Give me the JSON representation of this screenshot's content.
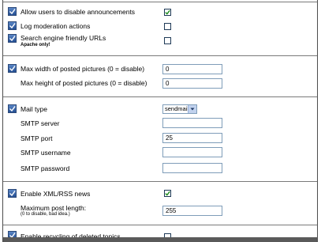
{
  "rows": {
    "allow_disable": {
      "label": "Allow users to disable announcements",
      "checked": true
    },
    "log_moderation": {
      "label": "Log moderation actions",
      "checked": false
    },
    "seo_urls": {
      "label": "Search engine friendly URLs",
      "sublabel": "Apache only!",
      "checked": false
    },
    "max_width": {
      "label": "Max width of posted pictures (0 = disable)",
      "value": "0"
    },
    "max_height": {
      "label": "Max height of posted pictures (0 = disable)",
      "value": "0"
    },
    "mail_type": {
      "label": "Mail type",
      "value": "sendmail"
    },
    "smtp_server": {
      "label": "SMTP server",
      "value": ""
    },
    "smtp_port": {
      "label": "SMTP port",
      "value": "25"
    },
    "smtp_username": {
      "label": "SMTP username",
      "value": ""
    },
    "smtp_password": {
      "label": "SMTP password",
      "value": ""
    },
    "xml_rss": {
      "label": "Enable XML/RSS news",
      "checked": true
    },
    "max_post_length": {
      "label": "Maximum post length:",
      "sublabel": "(0 to disable, bad idea.)",
      "value": "255"
    },
    "recycling": {
      "label": "Enable recycling of deleted topics",
      "checked": false
    }
  },
  "colors": {
    "help_icon": "#2f5fa8",
    "check": "#1a8a1a",
    "divider": "#7a7a7a"
  },
  "icons": {
    "help": "help-icon",
    "check": "checkmark-icon",
    "dropdown": "chevron-down-icon"
  }
}
